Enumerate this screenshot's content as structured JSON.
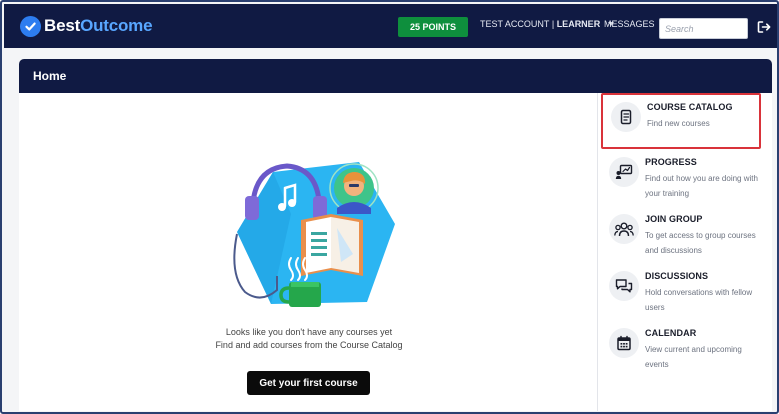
{
  "header": {
    "brand": {
      "part1": "Best",
      "part2": "Outcome"
    },
    "points_badge": "25 POINTS",
    "account": {
      "name": "TEST ACCOUNT",
      "separator": " | ",
      "role": "LEARNER"
    },
    "messages_label": "MESSAGES",
    "search": {
      "placeholder": "Search",
      "value": ""
    },
    "icons": {
      "logo": "checkmark-badge-icon",
      "logout": "logout-icon"
    }
  },
  "page": {
    "title": "Home"
  },
  "empty_state": {
    "line1": "Looks like you don't have any courses yet",
    "line2": "Find and add courses from the Course Catalog",
    "button_label": "Get your first course"
  },
  "sidebar": {
    "items": [
      {
        "title": "COURSE CATALOG",
        "description": "Find new courses",
        "icon": "book-icon",
        "highlighted": true
      },
      {
        "title": "PROGRESS",
        "description": "Find out how you are doing with your training",
        "icon": "presentation-chart-icon",
        "highlighted": false
      },
      {
        "title": "JOIN GROUP",
        "description": "To get access to group courses and discussions",
        "icon": "group-icon",
        "highlighted": false
      },
      {
        "title": "DISCUSSIONS",
        "description": "Hold conversations with fellow users",
        "icon": "chat-bubbles-icon",
        "highlighted": false
      },
      {
        "title": "CALENDAR",
        "description": "View current and upcoming events",
        "icon": "calendar-icon",
        "highlighted": false
      }
    ]
  },
  "colors": {
    "navy": "#101a43",
    "points_green": "#0e8f3d",
    "brand_blue": "#2d7df0",
    "highlight_red": "#d9333a",
    "illustration_blue": "#2bb5f2"
  }
}
